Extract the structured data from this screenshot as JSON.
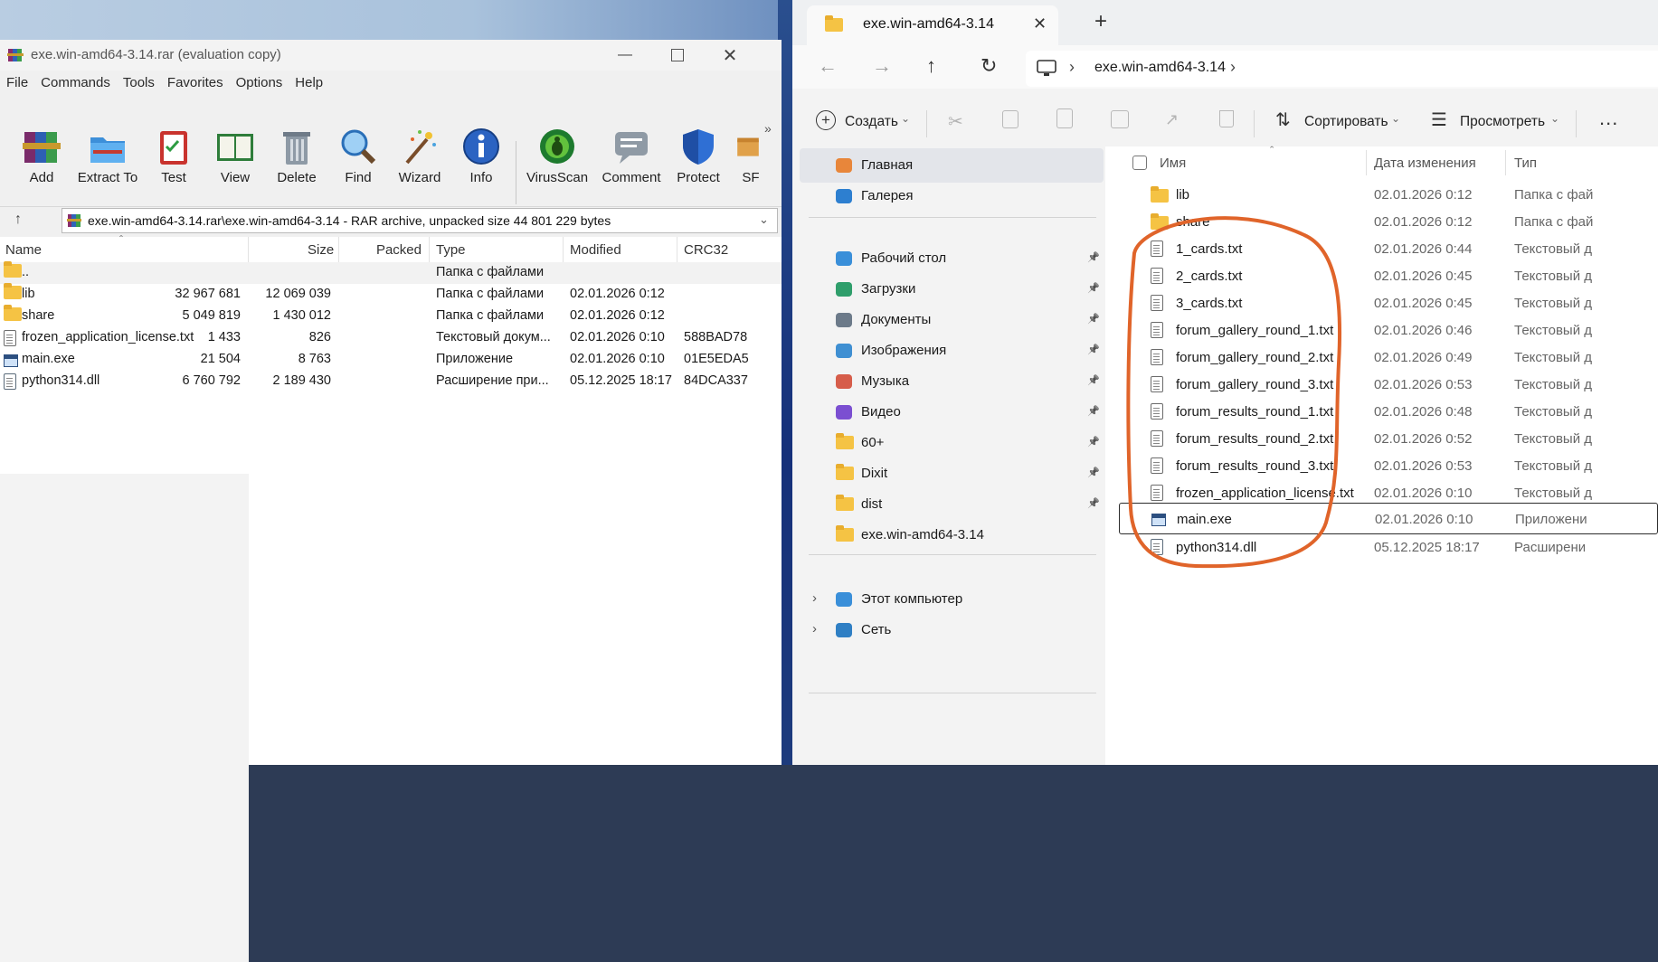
{
  "winrar": {
    "title": "exe.win-amd64-3.14.rar (evaluation copy)",
    "menu": [
      "File",
      "Commands",
      "Tools",
      "Favorites",
      "Options",
      "Help"
    ],
    "toolbar": [
      "Add",
      "Extract To",
      "Test",
      "View",
      "Delete",
      "Find",
      "Wizard",
      "Info",
      "VirusScan",
      "Comment",
      "Protect",
      "SF"
    ],
    "address": "exe.win-amd64-3.14.rar\\exe.win-amd64-3.14 - RAR archive, unpacked size 44 801 229 bytes",
    "columns": [
      "Name",
      "Size",
      "Packed",
      "Type",
      "Modified",
      "CRC32"
    ],
    "rows": [
      {
        "name": "..",
        "size": "",
        "packed": "",
        "type": "Папка с файлами",
        "modified": "",
        "crc": "",
        "icon": "folder-up-icon"
      },
      {
        "name": "lib",
        "size": "32 967 681",
        "packed": "12 069 039",
        "type": "Папка с файлами",
        "modified": "02.01.2026 0:12",
        "crc": "",
        "icon": "folder-icon"
      },
      {
        "name": "share",
        "size": "5 049 819",
        "packed": "1 430 012",
        "type": "Папка с файлами",
        "modified": "02.01.2026 0:12",
        "crc": "",
        "icon": "folder-icon"
      },
      {
        "name": "frozen_application_license.txt",
        "size": "1 433",
        "packed": "826",
        "type": "Текстовый докум...",
        "modified": "02.01.2026 0:10",
        "crc": "588BAD78",
        "icon": "text-file-icon"
      },
      {
        "name": "main.exe",
        "size": "21 504",
        "packed": "8 763",
        "type": "Приложение",
        "modified": "02.01.2026 0:10",
        "crc": "01E5EDA5",
        "icon": "exe-icon"
      },
      {
        "name": "python314.dll",
        "size": "6 760 792",
        "packed": "2 189 430",
        "type": "Расширение при...",
        "modified": "05.12.2025 18:17",
        "crc": "84DCA337",
        "icon": "dll-icon"
      }
    ]
  },
  "explorer": {
    "tab_title": "exe.win-amd64-3.14",
    "breadcrumb": "exe.win-amd64-3.14",
    "commands": {
      "create": "Создать",
      "sort": "Сортировать",
      "view": "Просмотреть",
      "more": "..."
    },
    "sidebar": [
      {
        "label": "Главная",
        "icon": "home-icon",
        "pinned": false
      },
      {
        "label": "Галерея",
        "icon": "gallery-icon",
        "pinned": false
      },
      {
        "label": "Рабочий стол",
        "icon": "desktop-icon",
        "pinned": true
      },
      {
        "label": "Загрузки",
        "icon": "downloads-icon",
        "pinned": true
      },
      {
        "label": "Документы",
        "icon": "documents-icon",
        "pinned": true
      },
      {
        "label": "Изображения",
        "icon": "pictures-icon",
        "pinned": true
      },
      {
        "label": "Музыка",
        "icon": "music-icon",
        "pinned": true
      },
      {
        "label": "Видео",
        "icon": "videos-icon",
        "pinned": true
      },
      {
        "label": "60+",
        "icon": "folder-icon",
        "pinned": true
      },
      {
        "label": "Dixit",
        "icon": "folder-icon",
        "pinned": true
      },
      {
        "label": "dist",
        "icon": "folder-icon",
        "pinned": true
      },
      {
        "label": "exe.win-amd64-3.14",
        "icon": "folder-icon",
        "pinned": false
      },
      {
        "label": "Этот компьютер",
        "icon": "this-pc-icon",
        "pinned": false
      },
      {
        "label": "Сеть",
        "icon": "network-icon",
        "pinned": false
      }
    ],
    "columns": [
      "Имя",
      "Дата изменения",
      "Тип"
    ],
    "files": [
      {
        "name": "lib",
        "date": "02.01.2026 0:12",
        "type": "Папка с фай",
        "icon": "folder-icon"
      },
      {
        "name": "share",
        "date": "02.01.2026 0:12",
        "type": "Папка с фай",
        "icon": "folder-icon"
      },
      {
        "name": "1_cards.txt",
        "date": "02.01.2026 0:44",
        "type": "Текстовый д",
        "icon": "text-file-icon"
      },
      {
        "name": "2_cards.txt",
        "date": "02.01.2026 0:45",
        "type": "Текстовый д",
        "icon": "text-file-icon"
      },
      {
        "name": "3_cards.txt",
        "date": "02.01.2026 0:45",
        "type": "Текстовый д",
        "icon": "text-file-icon"
      },
      {
        "name": "forum_gallery_round_1.txt",
        "date": "02.01.2026 0:46",
        "type": "Текстовый д",
        "icon": "text-file-icon"
      },
      {
        "name": "forum_gallery_round_2.txt",
        "date": "02.01.2026 0:49",
        "type": "Текстовый д",
        "icon": "text-file-icon"
      },
      {
        "name": "forum_gallery_round_3.txt",
        "date": "02.01.2026 0:53",
        "type": "Текстовый д",
        "icon": "text-file-icon"
      },
      {
        "name": "forum_results_round_1.txt",
        "date": "02.01.2026 0:48",
        "type": "Текстовый д",
        "icon": "text-file-icon"
      },
      {
        "name": "forum_results_round_2.txt",
        "date": "02.01.2026 0:52",
        "type": "Текстовый д",
        "icon": "text-file-icon"
      },
      {
        "name": "forum_results_round_3.txt",
        "date": "02.01.2026 0:53",
        "type": "Текстовый д",
        "icon": "text-file-icon"
      },
      {
        "name": "frozen_application_license.txt",
        "date": "02.01.2026 0:10",
        "type": "Текстовый д",
        "icon": "text-file-icon"
      },
      {
        "name": "main.exe",
        "date": "02.01.2026 0:10",
        "type": "Приложени",
        "icon": "exe-icon"
      },
      {
        "name": "python314.dll",
        "date": "05.12.2025 18:17",
        "type": "Расширени",
        "icon": "dll-icon"
      }
    ]
  },
  "colors": {
    "annotation": "#e0642a",
    "accent": "#0067c0"
  }
}
